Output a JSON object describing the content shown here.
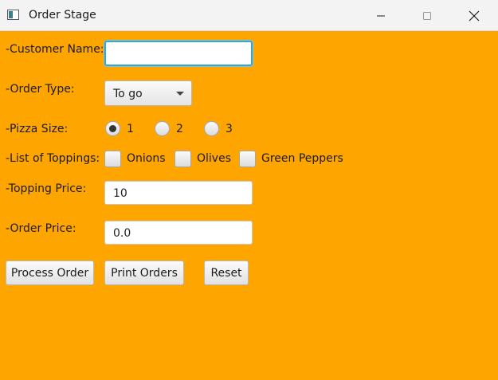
{
  "window": {
    "title": "Order Stage",
    "app_icon": "app-window-icon",
    "controls": [
      "minimize-icon",
      "maximize-icon",
      "close-icon"
    ]
  },
  "form": {
    "customer_name_label": "-Customer Name:",
    "customer_name_value": "",
    "order_type_label": "-Order Type:",
    "order_type_value": "To go",
    "pizza_size_label": "-Pizza Size:",
    "pizza_sizes": [
      {
        "label": "1",
        "selected": true
      },
      {
        "label": "2",
        "selected": false
      },
      {
        "label": "3",
        "selected": false
      }
    ],
    "toppings_label": "-List of Toppings:",
    "toppings": [
      {
        "label": "Onions",
        "checked": false
      },
      {
        "label": "Olives",
        "checked": false
      },
      {
        "label": "Green Peppers",
        "checked": false
      }
    ],
    "topping_price_label": "-Topping Price:",
    "topping_price_value": "10",
    "order_price_label": "-Order Price:",
    "order_price_value": "0.0"
  },
  "buttons": {
    "process": "Process Order",
    "print": "Print Orders",
    "reset": "Reset"
  },
  "colors": {
    "background": "#ffa500",
    "focus": "#39a5c7"
  }
}
